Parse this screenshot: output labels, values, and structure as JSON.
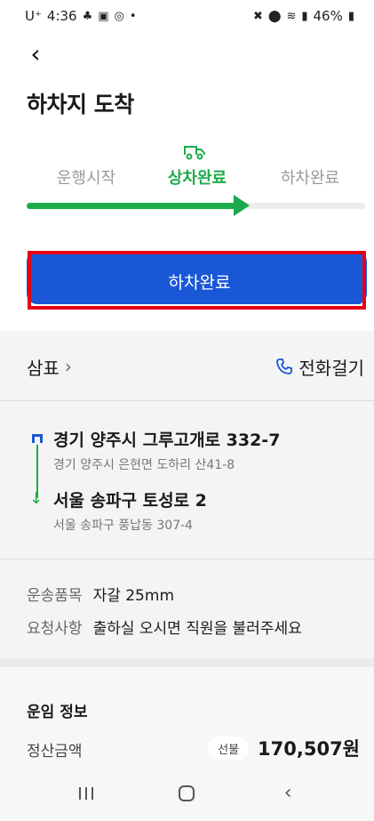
{
  "status_bar": {
    "carrier": "U⁺",
    "time": "4:36",
    "battery": "46%"
  },
  "header": {
    "back_icon": "back-arrow-icon",
    "title": "하차지 도착"
  },
  "steps": {
    "items": [
      {
        "label": "운행시작",
        "state": "done"
      },
      {
        "label": "상차완료",
        "state": "current"
      },
      {
        "label": "하차완료",
        "state": "pending"
      }
    ],
    "current_icon": "truck-icon",
    "progress": 0.66,
    "active_color": "#1aac4b"
  },
  "primary_action": {
    "label": "하차완료",
    "color": "#1a57d6",
    "highlight_color": "#e60012"
  },
  "company": {
    "name": "삼표",
    "call_label": "전화걸기"
  },
  "route": {
    "origin": {
      "address": "경기 양주시 그루고개로 332-7",
      "detail": "경기 양주시 은현면 도하리 산41-8"
    },
    "destination": {
      "address": "서울 송파구 토성로 2",
      "detail": "서울 송파구 풍납동 307-4"
    }
  },
  "cargo": {
    "item_label": "운송품목",
    "item_value": "자갈 25mm",
    "request_label": "요청사항",
    "request_value": "출하실 오시면 직원을 불러주세요"
  },
  "fare": {
    "title": "운임 정보",
    "amount_label": "정산금액",
    "payment_type": "선불",
    "amount": "170,507원"
  },
  "nav": {
    "recents_icon": "recents-icon",
    "home_icon": "home-icon",
    "back_icon": "back-icon"
  }
}
